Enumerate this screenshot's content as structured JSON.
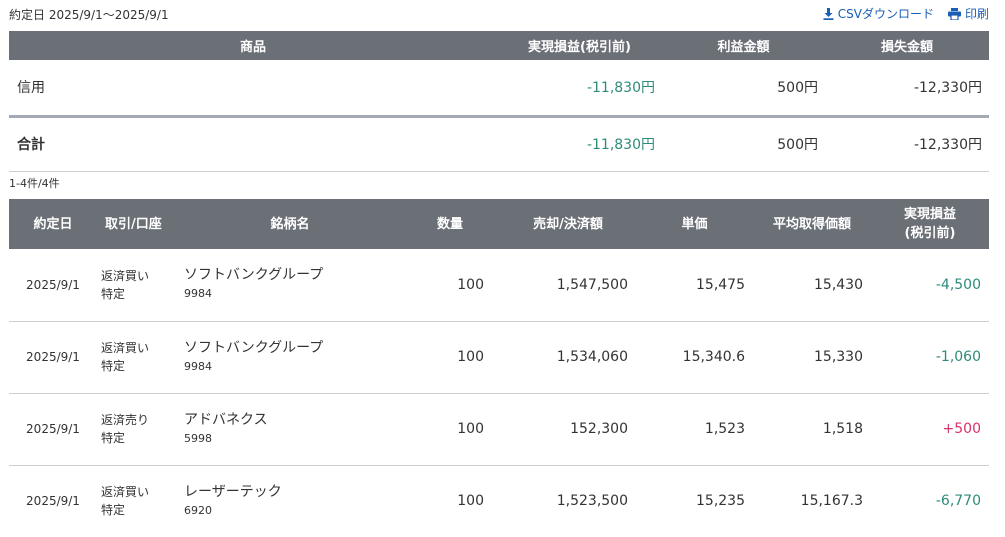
{
  "header": {
    "period_label": "約定日 2025/9/1〜2025/9/1",
    "csv_label": "CSVダウンロード",
    "print_label": "印刷",
    "icons": [
      "download-icon",
      "printer-icon"
    ]
  },
  "colors": {
    "header_bg": "#6b6f76",
    "negative": "#2e8b7a",
    "positive": "#d6336c",
    "link": "#1a5fb4"
  },
  "summary": {
    "columns": [
      "商品",
      "実現損益(税引前)",
      "利益金額",
      "損失金額"
    ],
    "rows": [
      {
        "name": "信用",
        "realized": "-11,830円",
        "profit": "500円",
        "loss": "-12,330円"
      },
      {
        "name": "合計",
        "realized": "-11,830円",
        "profit": "500円",
        "loss": "-12,330円"
      }
    ]
  },
  "count_label": "1-4件/4件",
  "detail": {
    "columns": {
      "date": "約定日",
      "trade": "取引/口座",
      "stock": "銘柄名",
      "qty": "数量",
      "amount": "売却/決済額",
      "price": "単価",
      "avg_cost": "平均取得価額",
      "pl_line1": "実現損益",
      "pl_line2": "(税引前)"
    },
    "rows": [
      {
        "date": "2025/9/1",
        "trade": "返済買い",
        "account": "特定",
        "stock": "ソフトバンクグループ",
        "code": "9984",
        "qty": "100",
        "amount": "1,547,500",
        "price": "15,475",
        "avg_cost": "15,430",
        "pl": "-4,500"
      },
      {
        "date": "2025/9/1",
        "trade": "返済買い",
        "account": "特定",
        "stock": "ソフトバンクグループ",
        "code": "9984",
        "qty": "100",
        "amount": "1,534,060",
        "price": "15,340.6",
        "avg_cost": "15,330",
        "pl": "-1,060"
      },
      {
        "date": "2025/9/1",
        "trade": "返済売り",
        "account": "特定",
        "stock": "アドバネクス",
        "code": "5998",
        "qty": "100",
        "amount": "152,300",
        "price": "1,523",
        "avg_cost": "1,518",
        "pl": "+500"
      },
      {
        "date": "2025/9/1",
        "trade": "返済買い",
        "account": "特定",
        "stock": "レーザーテック",
        "code": "6920",
        "qty": "100",
        "amount": "1,523,500",
        "price": "15,235",
        "avg_cost": "15,167.3",
        "pl": "-6,770"
      }
    ]
  }
}
